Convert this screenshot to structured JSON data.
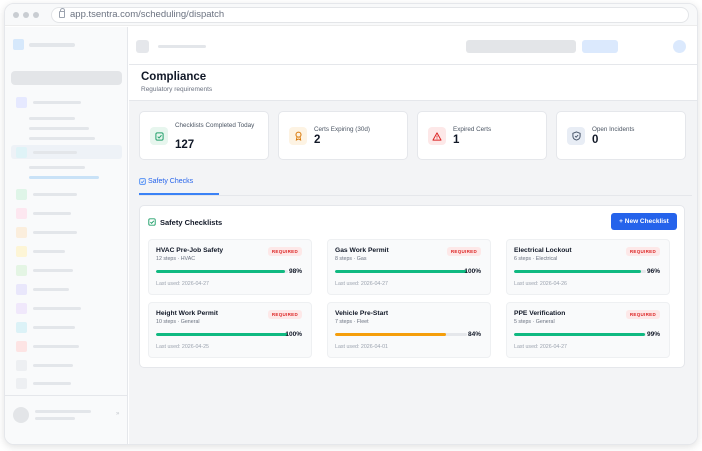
{
  "browser": {
    "url": "app.tsentra.com/scheduling/dispatch"
  },
  "page": {
    "title": "Compliance",
    "subtitle": "Regulatory requirements"
  },
  "stats": [
    {
      "label": "Checklists Completed Today",
      "value": "127",
      "icon": "checkbox-icon",
      "color": "#22a06b",
      "bg": "#e7f6ee"
    },
    {
      "label": "Certs Expiring (30d)",
      "value": "2",
      "icon": "award-icon",
      "color": "#d97706",
      "bg": "#fdf3e3"
    },
    {
      "label": "Expired Certs",
      "value": "1",
      "icon": "warning-icon",
      "color": "#dc2626",
      "bg": "#fde8e8"
    },
    {
      "label": "Open Incidents",
      "value": "0",
      "icon": "shield-icon",
      "color": "#475569",
      "bg": "#e8edf5"
    }
  ],
  "tabs": {
    "active": "Safety Checks"
  },
  "panel": {
    "title": "Safety Checklists",
    "new_button": "+ New Checklist"
  },
  "checklists": [
    {
      "name": "HVAC Pre-Job Safety",
      "meta": "12 steps · HVAC",
      "badge": "REQUIRED",
      "progress": 98,
      "pct": "98%",
      "last_used": "Last used: 2026-04-27",
      "color": "#10b981"
    },
    {
      "name": "Gas Work Permit",
      "meta": "8 steps · Gas",
      "badge": "REQUIRED",
      "progress": 100,
      "pct": "100%",
      "last_used": "Last used: 2026-04-27",
      "color": "#10b981"
    },
    {
      "name": "Electrical Lockout",
      "meta": "6 steps · Electrical",
      "badge": "REQUIRED",
      "progress": 96,
      "pct": "96%",
      "last_used": "Last used: 2026-04-26",
      "color": "#10b981"
    },
    {
      "name": "Height Work Permit",
      "meta": "10 steps · General",
      "badge": "REQUIRED",
      "progress": 100,
      "pct": "100%",
      "last_used": "Last used: 2026-04-25",
      "color": "#10b981"
    },
    {
      "name": "Vehicle Pre-Start",
      "meta": "7 steps · Fleet",
      "badge": "",
      "progress": 84,
      "pct": "84%",
      "last_used": "Last used: 2026-04-01",
      "color": "#f59e0b"
    },
    {
      "name": "PPE Verification",
      "meta": "5 steps · General",
      "badge": "REQUIRED",
      "progress": 99,
      "pct": "99%",
      "last_used": "Last used: 2026-04-27",
      "color": "#10b981"
    }
  ]
}
